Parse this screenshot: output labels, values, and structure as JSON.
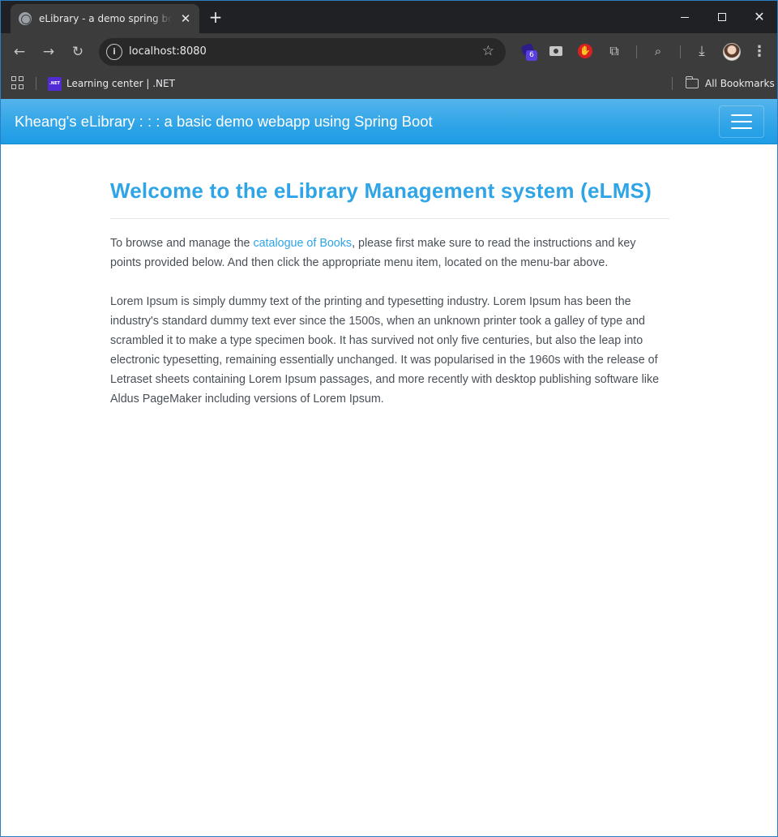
{
  "browser": {
    "tab": {
      "title": "eLibrary - a demo spring boot webapp",
      "close_glyph": "✕"
    },
    "new_tab_glyph": "+",
    "window_controls": {
      "close_glyph": "✕"
    },
    "toolbar": {
      "back_glyph": "←",
      "forward_glyph": "→",
      "reload_glyph": "↻",
      "site_info_glyph": "i",
      "url": "localhost:8080",
      "bookmark_star_glyph": "☆",
      "extension_badge_count": "6",
      "extension_stop_glyph": "✋",
      "extensions_glyph": "⧉",
      "tab_search_glyph": "⌕",
      "download_glyph": "⤓",
      "menu_glyph": "⋮"
    },
    "bookmarks": {
      "net_icon_text": ".NET",
      "items": [
        {
          "label": "Learning center | .NET"
        }
      ],
      "all_bookmarks_label": "All Bookmarks"
    }
  },
  "page": {
    "navbar": {
      "brand": "Kheang's eLibrary : : : a basic demo webapp using Spring Boot",
      "accent_color": "#2fa4e7"
    },
    "main": {
      "title": "Welcome to the eLibrary Management system (eLMS)",
      "intro_before_link": "To browse and manage the ",
      "intro_link": "catalogue of Books",
      "intro_after_link": ", please first make sure to read the instructions and key points provided below. And then click the appropriate menu item, located on the menu-bar above.",
      "lorem": "Lorem Ipsum is simply dummy text of the printing and typesetting industry. Lorem Ipsum has been the industry's standard dummy text ever since the 1500s, when an unknown printer took a galley of type and scrambled it to make a type specimen book. It has survived not only five centuries, but also the leap into electronic typesetting, remaining essentially unchanged. It was popularised in the 1960s with the release of Letraset sheets containing Lorem Ipsum passages, and more recently with desktop publishing software like Aldus PageMaker including versions of Lorem Ipsum."
    }
  }
}
